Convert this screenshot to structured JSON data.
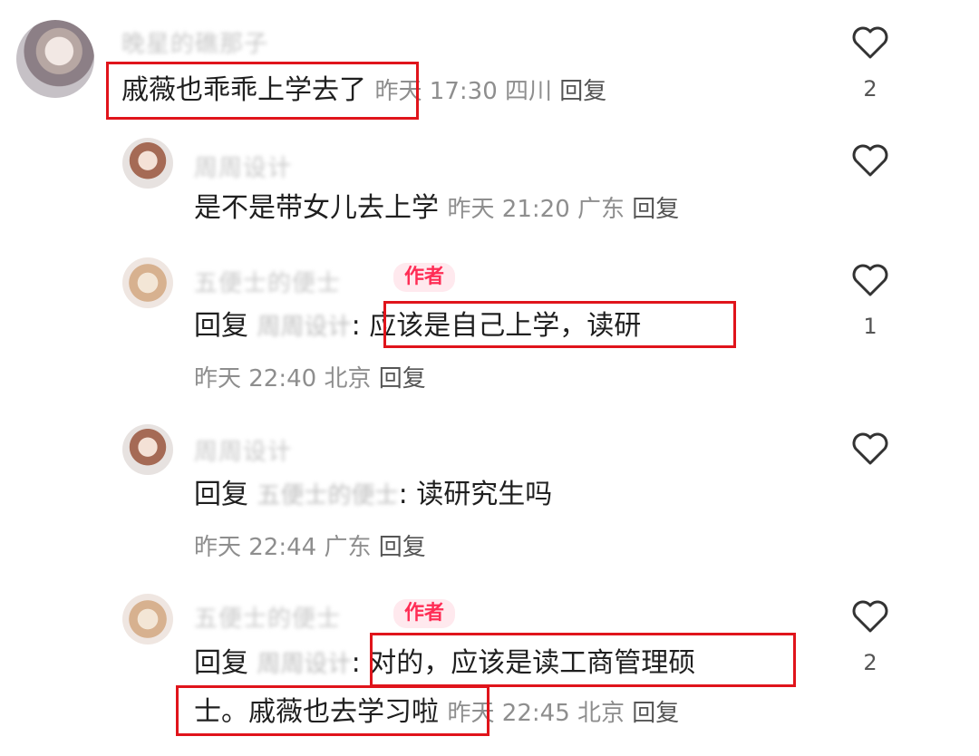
{
  "comments": [
    {
      "username": "晚星的礁那子",
      "text": "戚薇也乖乖上学去了",
      "meta": "昨天 17:30 四川",
      "reply": "回复",
      "likes": "2"
    },
    {
      "username": "周周设计",
      "text": "是不是带女儿去上学",
      "meta": "昨天 21:20 广东",
      "reply": "回复",
      "likes": ""
    },
    {
      "username": "五便士的便士",
      "author_tag": "作者",
      "reply_prefix": "回复",
      "mention": "周周设计",
      "text": ": 应该是自己上学，读研",
      "meta": "昨天 22:40 北京",
      "reply": "回复",
      "likes": "1"
    },
    {
      "username": "周周设计",
      "reply_prefix": "回复",
      "mention": "五便士的便士",
      "text": ": 读研究生吗",
      "meta": "昨天 22:44 广东",
      "reply": "回复",
      "likes": ""
    },
    {
      "username": "五便士的便士",
      "author_tag": "作者",
      "reply_prefix": "回复",
      "mention": "周周设计",
      "text_line1": ": 对的，应该是读工商管理硕",
      "text_line2": "士。戚薇也去学习啦",
      "meta": "昨天 22:45 北京",
      "reply": "回复",
      "likes": "2"
    }
  ],
  "icons": {
    "like": "heart-outline-icon"
  },
  "colors": {
    "highlight_box": "#e0141b",
    "author_tag": "#ff2d55"
  }
}
